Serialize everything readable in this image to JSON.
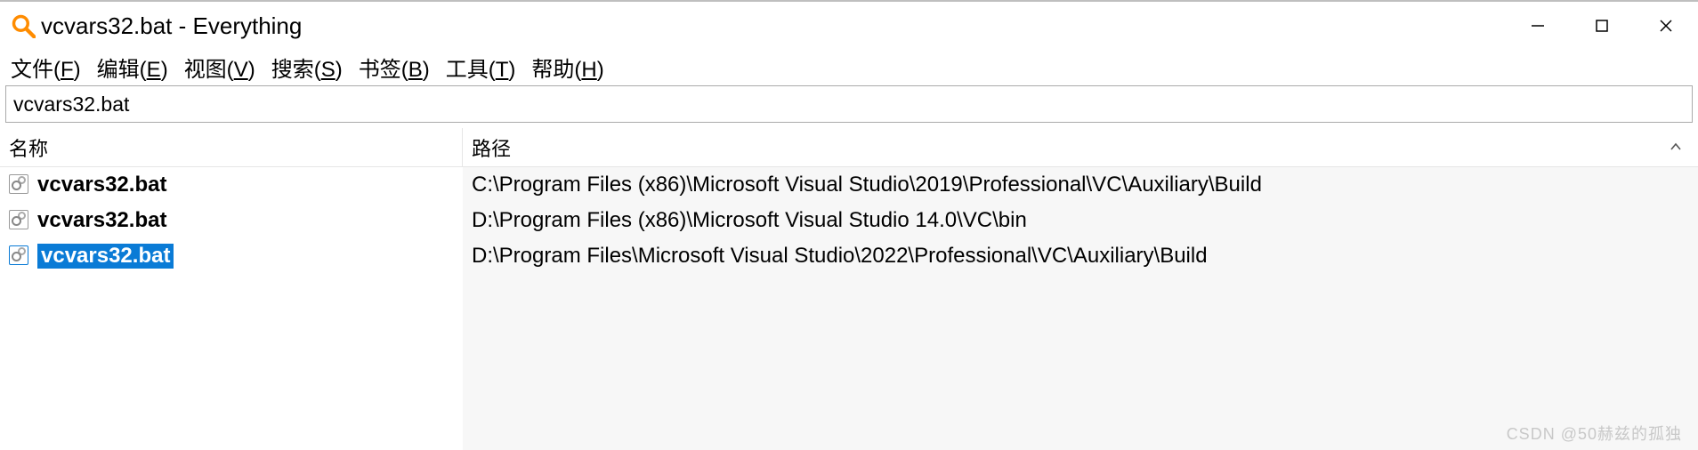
{
  "window": {
    "title": "vcvars32.bat - Everything"
  },
  "menu": {
    "file": "文件(F)",
    "edit": "编辑(E)",
    "view": "视图(V)",
    "search": "搜索(S)",
    "bookmarks": "书签(B)",
    "tools": "工具(T)",
    "help": "帮助(H)"
  },
  "search": {
    "value": "vcvars32.bat"
  },
  "columns": {
    "name": "名称",
    "path": "路径"
  },
  "results": [
    {
      "name": "vcvars32.bat",
      "path": "C:\\Program Files (x86)\\Microsoft Visual Studio\\2019\\Professional\\VC\\Auxiliary\\Build",
      "selected": false
    },
    {
      "name": "vcvars32.bat",
      "path": "D:\\Program Files (x86)\\Microsoft Visual Studio 14.0\\VC\\bin",
      "selected": false
    },
    {
      "name": "vcvars32.bat",
      "path": "D:\\Program Files\\Microsoft Visual Studio\\2022\\Professional\\VC\\Auxiliary\\Build",
      "selected": true
    }
  ],
  "watermark": "CSDN @50赫兹的孤独"
}
